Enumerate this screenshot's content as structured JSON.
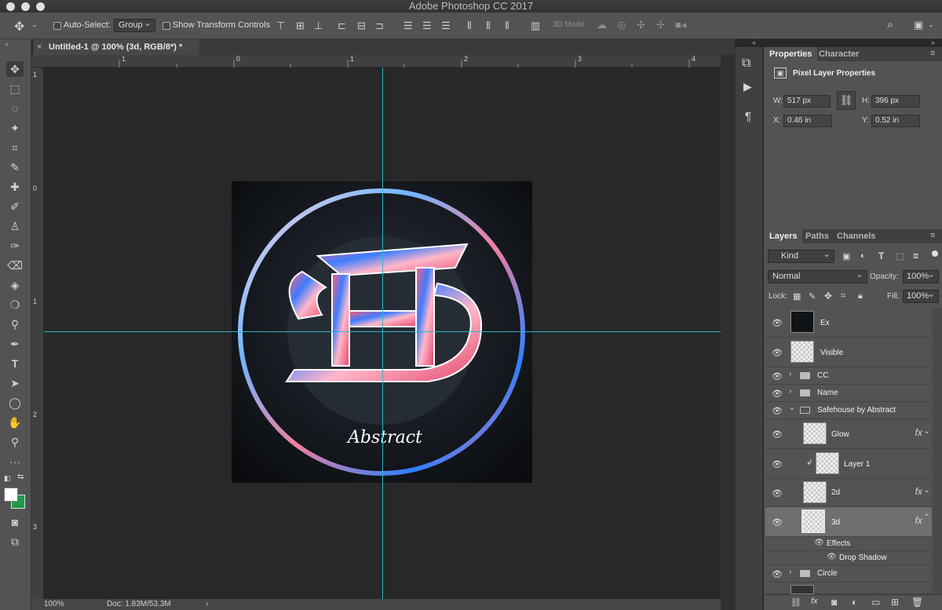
{
  "app": {
    "title": "Adobe Photoshop CC 2017"
  },
  "options_bar": {
    "auto_select_label": "Auto-Select:",
    "auto_select_value": "Group",
    "show_transform_label": "Show Transform Controls",
    "mode_3d_label": "3D Mode:"
  },
  "document": {
    "tab_title": "Untitled-1 @ 100% (3d, RGB/8*) *",
    "ruler_top_marks": [
      "1",
      "0",
      "1",
      "2",
      "3",
      "4"
    ],
    "ruler_left_marks": [
      "1",
      "0",
      "1",
      "2",
      "3"
    ],
    "artwork_text": "Abstract",
    "zoom": "100%",
    "doc_size": "Doc: 1.83M/53.3M"
  },
  "properties_panel": {
    "tabs": [
      "Properties",
      "Character"
    ],
    "header": "Pixel Layer Properties",
    "w_label": "W:",
    "w_value": "517 px",
    "h_label": "H:",
    "h_value": "396 px",
    "x_label": "X:",
    "x_value": "0.46 in",
    "y_label": "Y:",
    "y_value": "0.52 in"
  },
  "layers_panel": {
    "tabs": [
      "Layers",
      "Paths",
      "Channels"
    ],
    "filter_value": "Kind",
    "blend_mode": "Normal",
    "opacity_label": "Opacity:",
    "opacity_value": "100%",
    "lock_label": "Lock:",
    "fill_label": "Fill:",
    "fill_value": "100%",
    "layers": [
      {
        "name": "Ex"
      },
      {
        "name": "Visible"
      },
      {
        "name": "CC"
      },
      {
        "name": "Name"
      },
      {
        "name": "Safehouse by Abstract"
      },
      {
        "name": "Glow",
        "fx": "fx"
      },
      {
        "name": "Layer 1"
      },
      {
        "name": "2d",
        "fx": "fx"
      },
      {
        "name": "3d",
        "fx": "fx"
      },
      {
        "name": "Effects"
      },
      {
        "name": "Drop Shadow"
      },
      {
        "name": "Circle"
      }
    ]
  },
  "colors": {
    "accent_green": "#1e9b4a",
    "guide": "#2fb6c7"
  }
}
